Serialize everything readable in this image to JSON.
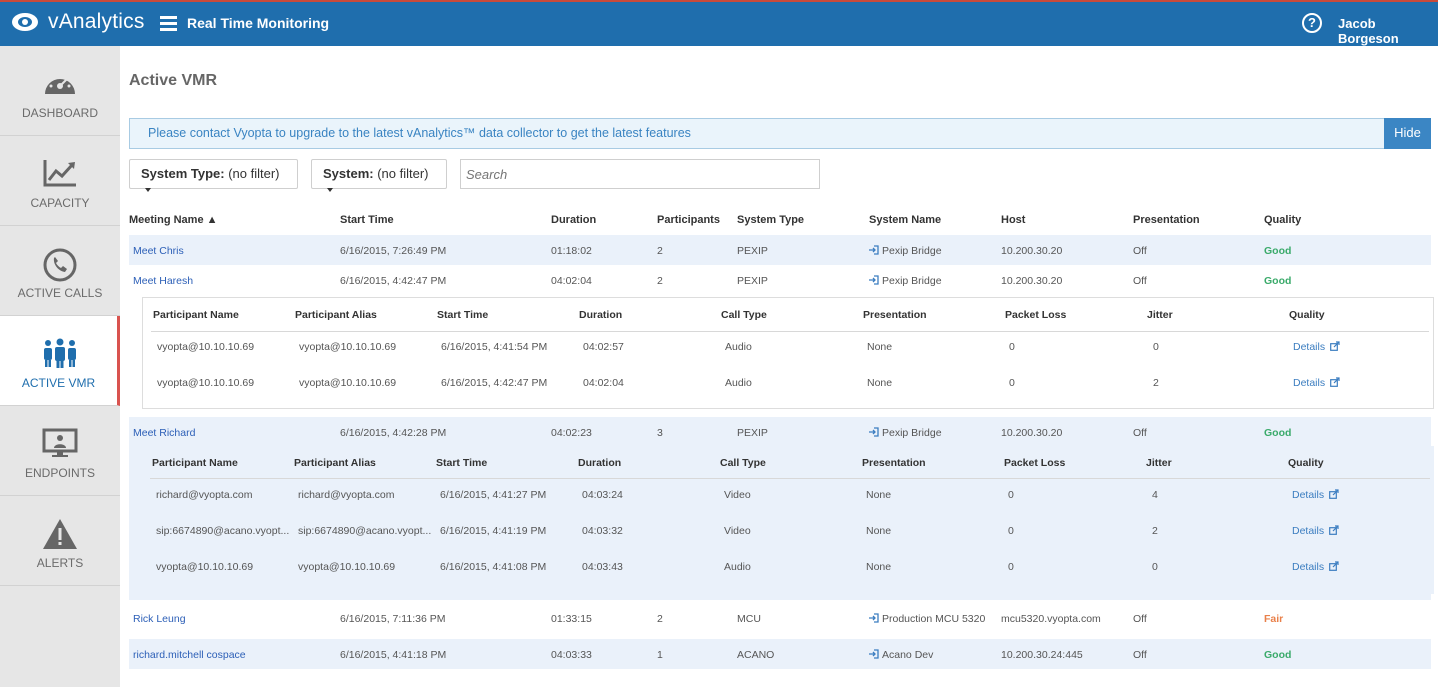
{
  "header": {
    "brand": "vAnalytics",
    "page": "Real Time Monitoring",
    "user": "Jacob Borgeson",
    "help": "?"
  },
  "sidebar": {
    "items": [
      {
        "label": "DASHBOARD",
        "icon": "dashboard-gauge-icon"
      },
      {
        "label": "CAPACITY",
        "icon": "capacity-chart-icon"
      },
      {
        "label": "ACTIVE CALLS",
        "icon": "phone-icon"
      },
      {
        "label": "ACTIVE VMR",
        "icon": "people-icon",
        "active": true
      },
      {
        "label": "ENDPOINTS",
        "icon": "monitor-icon"
      },
      {
        "label": "ALERTS",
        "icon": "warning-icon"
      }
    ]
  },
  "main": {
    "title": "Active VMR",
    "notice": {
      "text": "Please contact Vyopta to upgrade to the latest vAnalytics™ data collector to get the latest features",
      "button": "Hide"
    },
    "filters": {
      "system_type_label": "System Type:",
      "system_type_value": "(no filter)",
      "system_label": "System:",
      "system_value": "(no filter)",
      "search_placeholder": "Search"
    },
    "columns": [
      "Meeting Name ▲",
      "Start Time",
      "Duration",
      "Participants",
      "System Type",
      "System Name",
      "Host",
      "Presentation",
      "Quality"
    ],
    "sub_columns": [
      "Participant Name",
      "Participant Alias",
      "Start Time",
      "Duration",
      "Call Type",
      "Presentation",
      "Packet Loss",
      "Jitter",
      "Quality"
    ],
    "meetings": [
      {
        "name": "Meet Chris",
        "start": "6/16/2015, 7:26:49 PM",
        "duration": "01:18:02",
        "participants": "2",
        "system_type": "PEXIP",
        "system_name": "Pexip Bridge",
        "host": "10.200.30.20",
        "presentation": "Off",
        "quality": "Good"
      },
      {
        "name": "Meet Haresh",
        "start": "6/16/2015, 4:42:47 PM",
        "duration": "04:02:04",
        "participants": "2",
        "system_type": "PEXIP",
        "system_name": "Pexip Bridge",
        "host": "10.200.30.20",
        "presentation": "Off",
        "quality": "Good",
        "participants_list": [
          {
            "name": "vyopta@10.10.10.69",
            "alias": "vyopta@10.10.10.69",
            "start": "6/16/2015, 4:41:54 PM",
            "duration": "04:02:57",
            "call_type": "Audio",
            "presentation": "None",
            "packet_loss": "0",
            "jitter": "0",
            "quality": "Details"
          },
          {
            "name": "vyopta@10.10.10.69",
            "alias": "vyopta@10.10.10.69",
            "start": "6/16/2015, 4:42:47 PM",
            "duration": "04:02:04",
            "call_type": "Audio",
            "presentation": "None",
            "packet_loss": "0",
            "jitter": "2",
            "quality": "Details"
          }
        ]
      },
      {
        "name": "Meet Richard",
        "start": "6/16/2015, 4:42:28 PM",
        "duration": "04:02:23",
        "participants": "3",
        "system_type": "PEXIP",
        "system_name": "Pexip Bridge",
        "host": "10.200.30.20",
        "presentation": "Off",
        "quality": "Good",
        "participants_list": [
          {
            "name": "richard@vyopta.com",
            "alias": "richard@vyopta.com",
            "start": "6/16/2015, 4:41:27 PM",
            "duration": "04:03:24",
            "call_type": "Video",
            "presentation": "None",
            "packet_loss": "0",
            "jitter": "4",
            "quality": "Details"
          },
          {
            "name": "sip:6674890@acano.vyopt...",
            "alias": "sip:6674890@acano.vyopt...",
            "start": "6/16/2015, 4:41:19 PM",
            "duration": "04:03:32",
            "call_type": "Video",
            "presentation": "None",
            "packet_loss": "0",
            "jitter": "2",
            "quality": "Details"
          },
          {
            "name": "vyopta@10.10.10.69",
            "alias": "vyopta@10.10.10.69",
            "start": "6/16/2015, 4:41:08 PM",
            "duration": "04:03:43",
            "call_type": "Audio",
            "presentation": "None",
            "packet_loss": "0",
            "jitter": "0",
            "quality": "Details"
          }
        ]
      },
      {
        "name": "Rick Leung",
        "start": "6/16/2015, 7:11:36 PM",
        "duration": "01:33:15",
        "participants": "2",
        "system_type": "MCU",
        "system_name": "Production MCU 5320",
        "host": "mcu5320.vyopta.com",
        "presentation": "Off",
        "quality": "Fair"
      },
      {
        "name": "richard.mitchell cospace",
        "start": "6/16/2015, 4:41:18 PM",
        "duration": "04:03:33",
        "participants": "1",
        "system_type": "ACANO",
        "system_name": "Acano Dev",
        "host": "10.200.30.24:445",
        "presentation": "Off",
        "quality": "Good"
      }
    ]
  },
  "colors": {
    "header": "#1f6ead",
    "good": "#3aaa6a",
    "fair": "#e9804a",
    "link": "#2c5fb7",
    "active_border": "#d9534f"
  }
}
